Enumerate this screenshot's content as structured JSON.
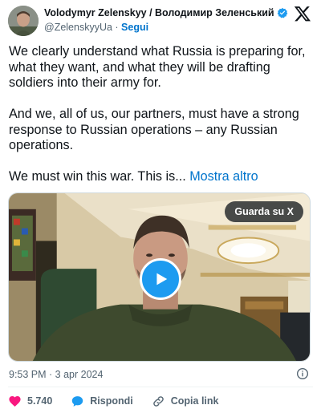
{
  "author": {
    "display_name": "Volodymyr Zelenskyy / Володимир Зеленський",
    "handle": "@ZelenskyyUa",
    "separator": " · ",
    "follow_label": "Segui",
    "verified_icon": "verified-badge-icon"
  },
  "tweet": {
    "paragraphs": [
      "We clearly understand what Russia is preparing for, what they want, and what they will be drafting soldiers into their army for.",
      "And we, all of us, our partners, must have a strong response to Russian operations – any Russian operations."
    ],
    "last_text": "We must win this war. This is... ",
    "show_more": "Mostra altro"
  },
  "media": {
    "watch_label": "Guarda su X",
    "play_icon": "play-icon"
  },
  "meta": {
    "timestamp": "9:53 PM · 3 apr 2024",
    "info_icon": "info-icon"
  },
  "actions": {
    "like_count": "5.740",
    "reply_label": "Rispondi",
    "copy_link_label": "Copia link"
  },
  "colors": {
    "accent": "#1d9bf0",
    "link": "#0074cc",
    "like": "#f91880",
    "text": "#0f1419",
    "muted": "#536471"
  }
}
